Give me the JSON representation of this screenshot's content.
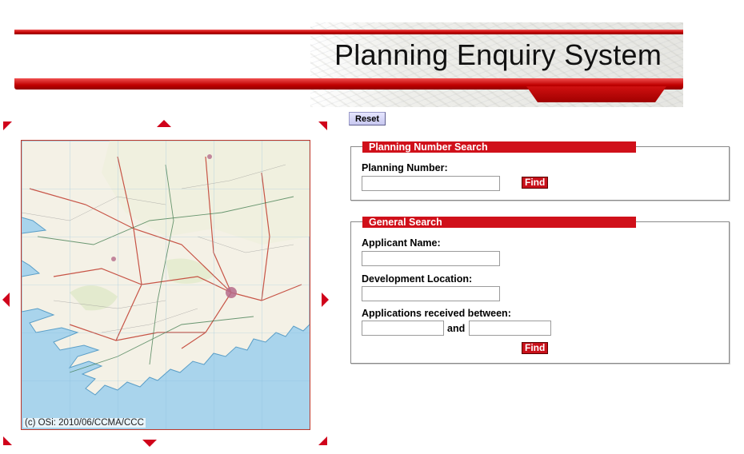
{
  "header": {
    "title": "Planning Enquiry System"
  },
  "map": {
    "credit": "(c) OSi: 2010/06/CCMA/CCC",
    "nav_arrows": [
      "north",
      "south",
      "west",
      "east",
      "north-west",
      "north-east",
      "south-west",
      "south-east"
    ],
    "colors": {
      "sea": "#a9d4ec",
      "land": "#f4f1e6",
      "roads": "#c0392b"
    }
  },
  "toolbar": {
    "reset_label": "Reset"
  },
  "planning_number_search": {
    "legend": "Planning Number Search",
    "number_label": "Planning Number:",
    "number_value": "",
    "find_label": "Find"
  },
  "general_search": {
    "legend": "General Search",
    "applicant_label": "Applicant Name:",
    "applicant_value": "",
    "location_label": "Development Location:",
    "location_value": "",
    "dates_label": "Applications received between:",
    "date_from_value": "",
    "and_label": "and",
    "date_to_value": "",
    "find_label": "Find"
  },
  "colors": {
    "accent": "#d0101a",
    "border": "#8a8a8a",
    "reset_button": "#d6d6f8"
  }
}
